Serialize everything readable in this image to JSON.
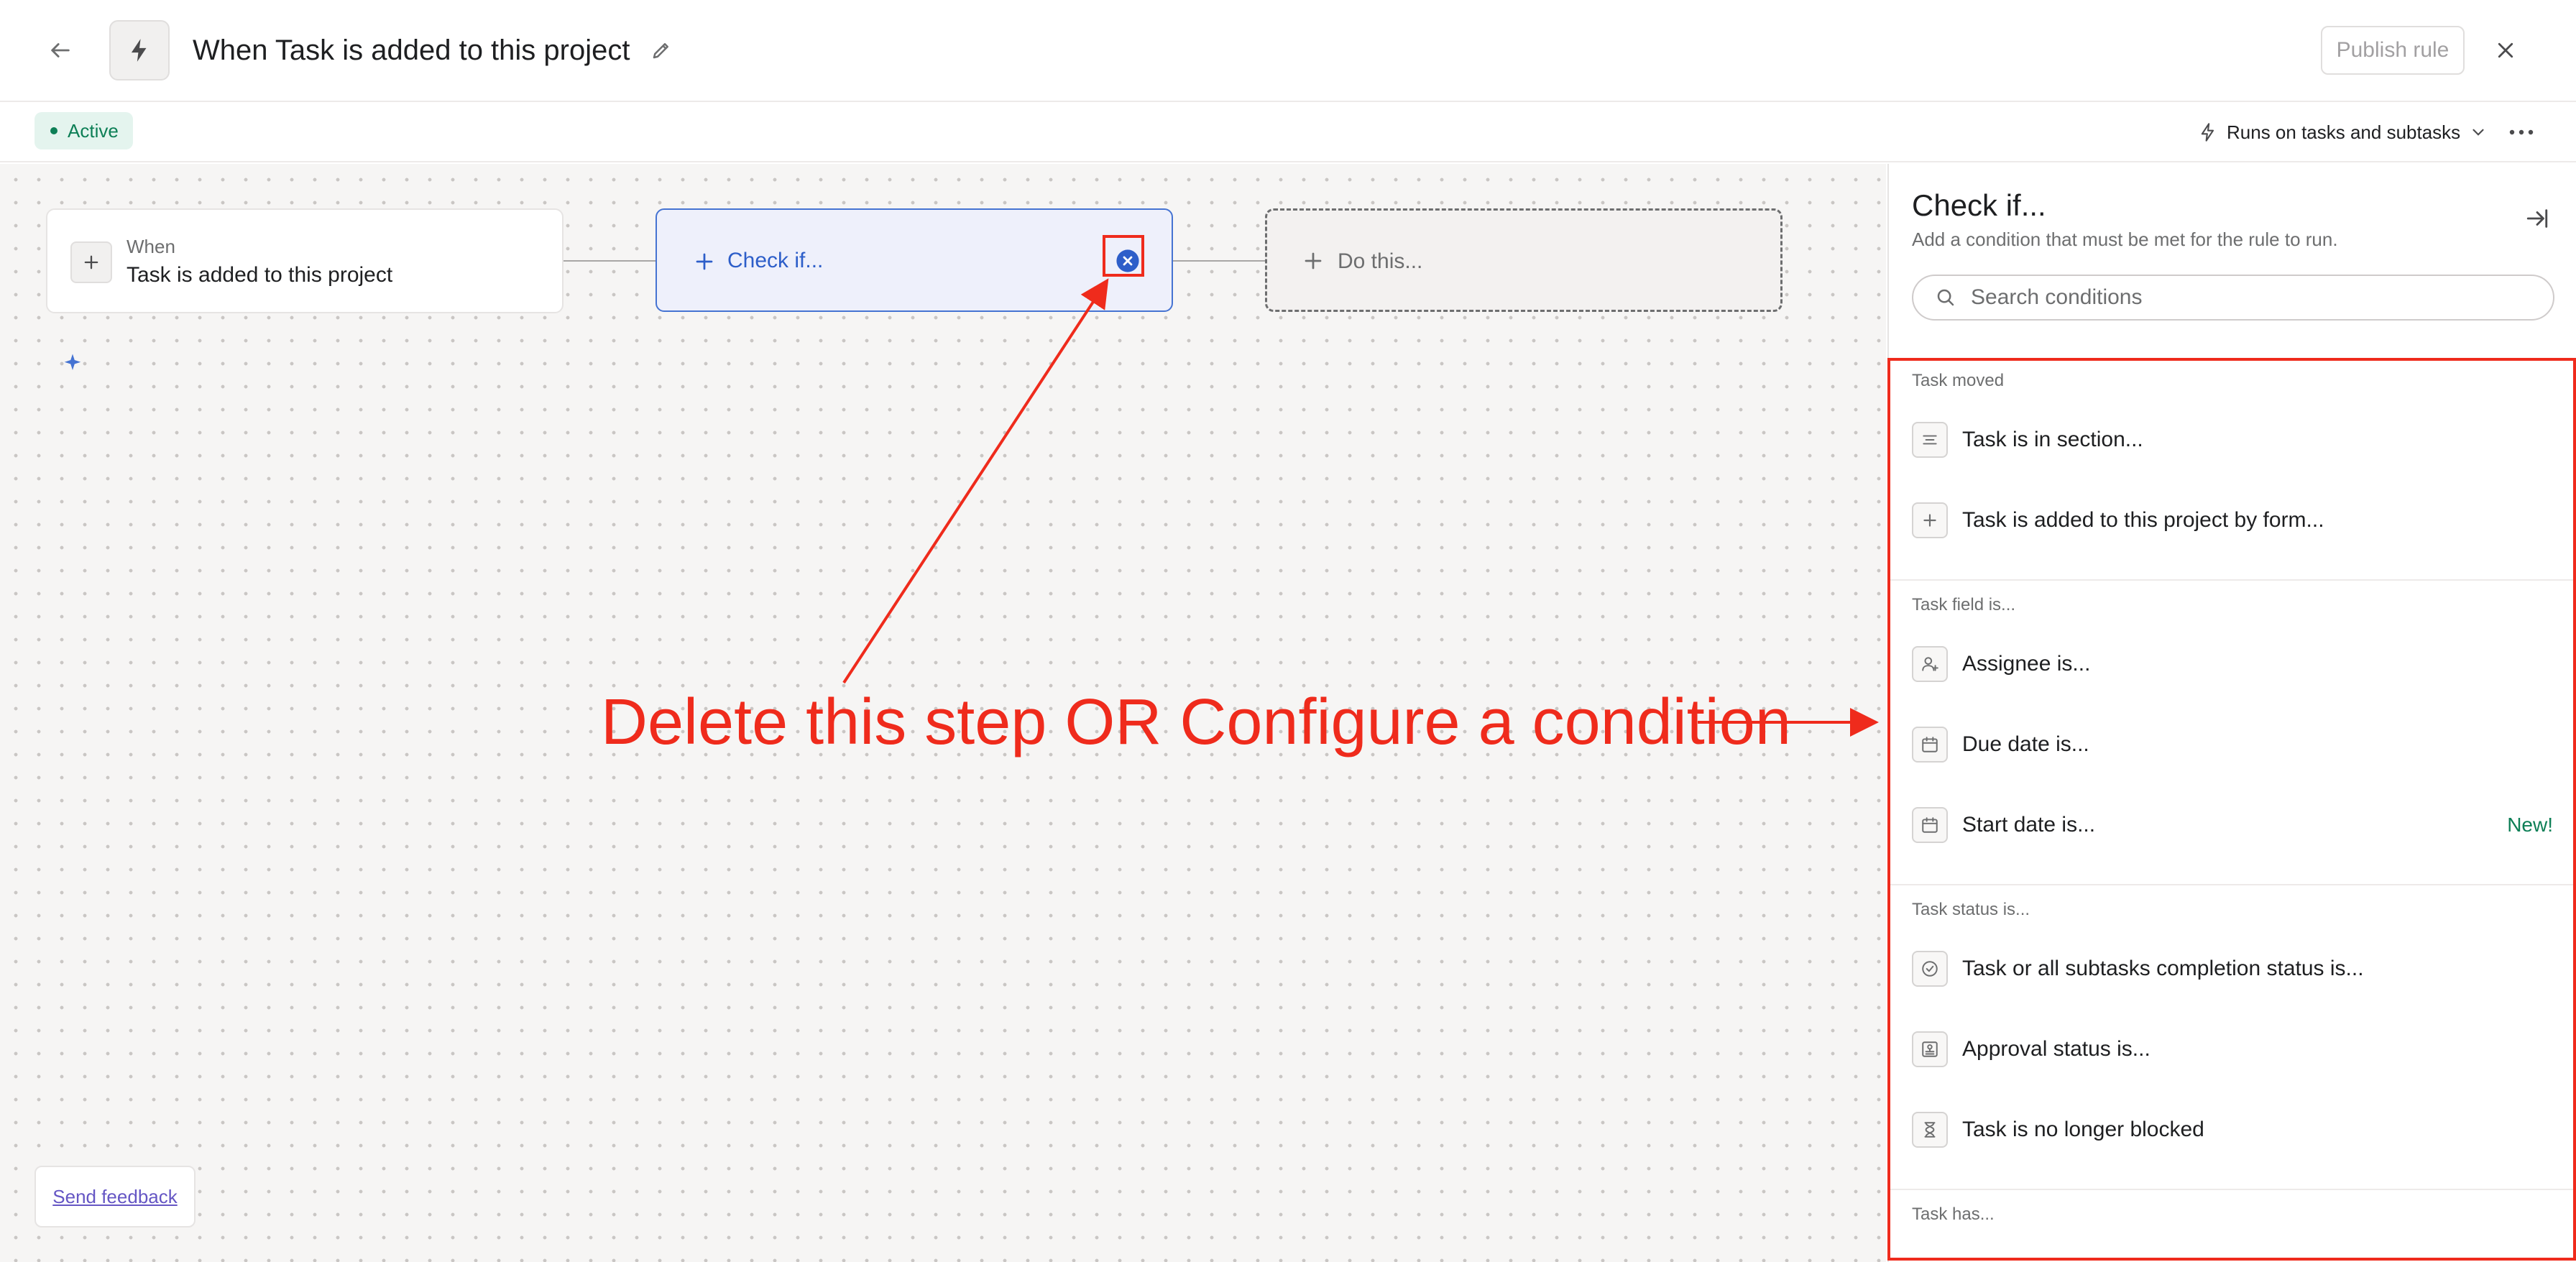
{
  "header": {
    "rule_title": "When Task is added to this project",
    "publish_label": "Publish rule"
  },
  "subheader": {
    "status": "Active",
    "runs_on": "Runs on tasks and subtasks"
  },
  "canvas": {
    "when_card": {
      "label": "When",
      "value": "Task is added to this project"
    },
    "check_card": {
      "label": "Check if..."
    },
    "do_card": {
      "label": "Do this..."
    },
    "feedback_label": "Send feedback"
  },
  "annotation": {
    "text": "Delete this step OR Configure a condition",
    "color": "#ef2b1c"
  },
  "panel": {
    "title": "Check if...",
    "subtitle": "Add a condition that must be met for the rule to run.",
    "search_placeholder": "Search conditions",
    "groups": [
      {
        "title": "Task moved",
        "items": [
          {
            "label": "Task is in section...",
            "icon": "section-icon"
          },
          {
            "label": "Task is added to this project by form...",
            "icon": "plus-icon"
          }
        ]
      },
      {
        "title": "Task field is...",
        "items": [
          {
            "label": "Assignee is...",
            "icon": "person-icon"
          },
          {
            "label": "Due date is...",
            "icon": "calendar-icon"
          },
          {
            "label": "Start date is...",
            "icon": "calendar-icon",
            "badge": "New!"
          }
        ]
      },
      {
        "title": "Task status is...",
        "items": [
          {
            "label": "Task or all subtasks completion status is...",
            "icon": "check-circle-icon"
          },
          {
            "label": "Approval status is...",
            "icon": "stamp-icon"
          },
          {
            "label": "Task is no longer blocked",
            "icon": "hourglass-icon"
          }
        ]
      },
      {
        "title": "Task has...",
        "items": []
      }
    ]
  },
  "colors": {
    "accent_blue": "#4573d2",
    "active_green": "#0d7f56",
    "annotation_red": "#ef2b1c"
  }
}
